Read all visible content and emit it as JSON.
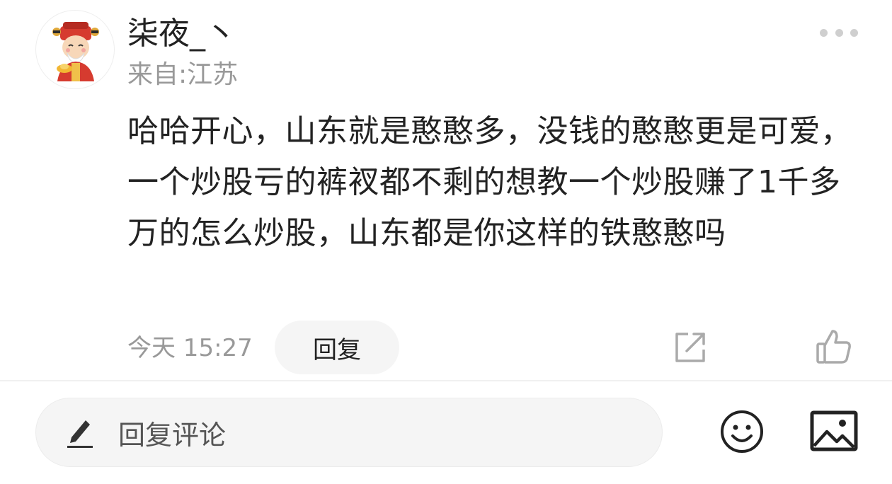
{
  "comment": {
    "author": {
      "name": "柒夜_丶",
      "location": "来自:江苏",
      "avatar_icon": "god-of-wealth-avatar-icon"
    },
    "text": "哈哈开心，山东就是憨憨多，没钱的憨憨更是可爱，一个炒股亏的裤衩都不剩的想教一个炒股赚了1千多万的怎么炒股，山东都是你这样的铁憨憨吗",
    "time": "今天 15:27",
    "reply_label": "回复",
    "more_icon": "more-dots-icon",
    "share_icon": "share-icon",
    "like_icon": "thumbs-up-icon"
  },
  "input_bar": {
    "placeholder": "回复评论",
    "pencil_icon": "pencil-icon",
    "emoji_icon": "emoji-icon",
    "image_icon": "image-icon"
  },
  "colors": {
    "text_primary": "#222222",
    "text_secondary": "#999999",
    "pill_background": "#f5f5f5",
    "icon_gray": "#aaaaaa",
    "icon_dark": "#222222"
  }
}
